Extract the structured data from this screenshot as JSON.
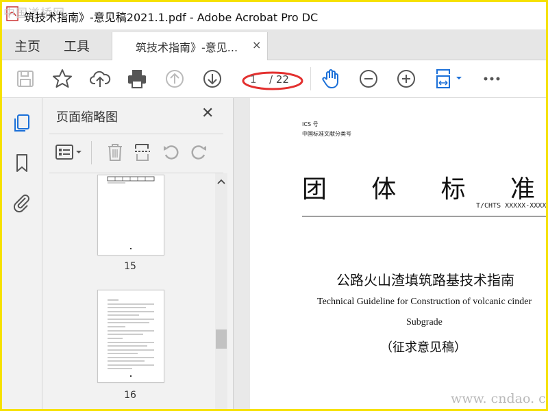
{
  "window": {
    "title": "筑技术指南》-意见稿2021.1.pdf - Adobe Acrobat Pro DC",
    "watermark": "中国道桥网"
  },
  "tabs": {
    "home": "主页",
    "tools": "工具",
    "document": "筑技术指南》-意见...",
    "close_glyph": "×"
  },
  "toolbar": {
    "icons": [
      "save-icon",
      "bookmark-star-icon",
      "cloud-upload-icon",
      "print-icon",
      "page-up-icon",
      "page-down-icon",
      "hand-tool-icon",
      "zoom-out-icon",
      "zoom-in-icon",
      "fit-page-icon",
      "more-icon"
    ],
    "page_current": "1",
    "page_total": "/ 22",
    "highlight_color": "#e3302f"
  },
  "thumbnails": {
    "title": "页面缩略图",
    "close_glyph": "✕",
    "pages": [
      {
        "label": "15"
      },
      {
        "label": "16"
      }
    ]
  },
  "document": {
    "ics": "ICS 号",
    "classification": "中国标准文献分类号",
    "standard_title": [
      "团",
      "体",
      "标",
      "准"
    ],
    "standard_code": "T/CHTS XXXXX-XXXX",
    "title_cn": "公路火山渣填筑路基技术指南",
    "title_en_1": "Technical Guideline for Construction of  volcanic cinder",
    "title_en_2": "Subgrade",
    "draft_label": "（征求意见稿）"
  },
  "footer": {
    "url_watermark": "www. cndao. com"
  },
  "colors": {
    "frame": "#f6e100",
    "accent_blue": "#1a6fd8",
    "icon_gray": "#555555"
  }
}
